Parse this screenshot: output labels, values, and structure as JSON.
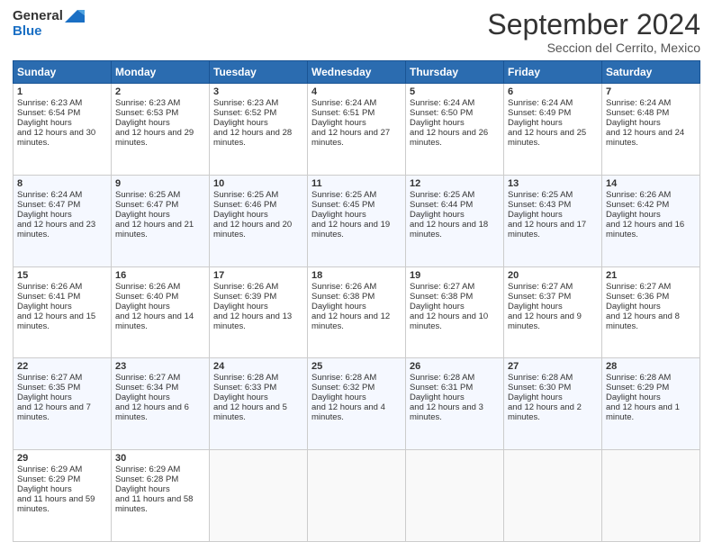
{
  "logo": {
    "line1": "General",
    "line2": "Blue"
  },
  "header": {
    "title": "September 2024",
    "subtitle": "Seccion del Cerrito, Mexico"
  },
  "columns": [
    "Sunday",
    "Monday",
    "Tuesday",
    "Wednesday",
    "Thursday",
    "Friday",
    "Saturday"
  ],
  "weeks": [
    [
      {
        "day": "1",
        "sunrise": "6:23 AM",
        "sunset": "6:54 PM",
        "daylight": "12 hours and 30 minutes."
      },
      {
        "day": "2",
        "sunrise": "6:23 AM",
        "sunset": "6:53 PM",
        "daylight": "12 hours and 29 minutes."
      },
      {
        "day": "3",
        "sunrise": "6:23 AM",
        "sunset": "6:52 PM",
        "daylight": "12 hours and 28 minutes."
      },
      {
        "day": "4",
        "sunrise": "6:24 AM",
        "sunset": "6:51 PM",
        "daylight": "12 hours and 27 minutes."
      },
      {
        "day": "5",
        "sunrise": "6:24 AM",
        "sunset": "6:50 PM",
        "daylight": "12 hours and 26 minutes."
      },
      {
        "day": "6",
        "sunrise": "6:24 AM",
        "sunset": "6:49 PM",
        "daylight": "12 hours and 25 minutes."
      },
      {
        "day": "7",
        "sunrise": "6:24 AM",
        "sunset": "6:48 PM",
        "daylight": "12 hours and 24 minutes."
      }
    ],
    [
      {
        "day": "8",
        "sunrise": "6:24 AM",
        "sunset": "6:47 PM",
        "daylight": "12 hours and 23 minutes."
      },
      {
        "day": "9",
        "sunrise": "6:25 AM",
        "sunset": "6:47 PM",
        "daylight": "12 hours and 21 minutes."
      },
      {
        "day": "10",
        "sunrise": "6:25 AM",
        "sunset": "6:46 PM",
        "daylight": "12 hours and 20 minutes."
      },
      {
        "day": "11",
        "sunrise": "6:25 AM",
        "sunset": "6:45 PM",
        "daylight": "12 hours and 19 minutes."
      },
      {
        "day": "12",
        "sunrise": "6:25 AM",
        "sunset": "6:44 PM",
        "daylight": "12 hours and 18 minutes."
      },
      {
        "day": "13",
        "sunrise": "6:25 AM",
        "sunset": "6:43 PM",
        "daylight": "12 hours and 17 minutes."
      },
      {
        "day": "14",
        "sunrise": "6:26 AM",
        "sunset": "6:42 PM",
        "daylight": "12 hours and 16 minutes."
      }
    ],
    [
      {
        "day": "15",
        "sunrise": "6:26 AM",
        "sunset": "6:41 PM",
        "daylight": "12 hours and 15 minutes."
      },
      {
        "day": "16",
        "sunrise": "6:26 AM",
        "sunset": "6:40 PM",
        "daylight": "12 hours and 14 minutes."
      },
      {
        "day": "17",
        "sunrise": "6:26 AM",
        "sunset": "6:39 PM",
        "daylight": "12 hours and 13 minutes."
      },
      {
        "day": "18",
        "sunrise": "6:26 AM",
        "sunset": "6:38 PM",
        "daylight": "12 hours and 12 minutes."
      },
      {
        "day": "19",
        "sunrise": "6:27 AM",
        "sunset": "6:38 PM",
        "daylight": "12 hours and 10 minutes."
      },
      {
        "day": "20",
        "sunrise": "6:27 AM",
        "sunset": "6:37 PM",
        "daylight": "12 hours and 9 minutes."
      },
      {
        "day": "21",
        "sunrise": "6:27 AM",
        "sunset": "6:36 PM",
        "daylight": "12 hours and 8 minutes."
      }
    ],
    [
      {
        "day": "22",
        "sunrise": "6:27 AM",
        "sunset": "6:35 PM",
        "daylight": "12 hours and 7 minutes."
      },
      {
        "day": "23",
        "sunrise": "6:27 AM",
        "sunset": "6:34 PM",
        "daylight": "12 hours and 6 minutes."
      },
      {
        "day": "24",
        "sunrise": "6:28 AM",
        "sunset": "6:33 PM",
        "daylight": "12 hours and 5 minutes."
      },
      {
        "day": "25",
        "sunrise": "6:28 AM",
        "sunset": "6:32 PM",
        "daylight": "12 hours and 4 minutes."
      },
      {
        "day": "26",
        "sunrise": "6:28 AM",
        "sunset": "6:31 PM",
        "daylight": "12 hours and 3 minutes."
      },
      {
        "day": "27",
        "sunrise": "6:28 AM",
        "sunset": "6:30 PM",
        "daylight": "12 hours and 2 minutes."
      },
      {
        "day": "28",
        "sunrise": "6:28 AM",
        "sunset": "6:29 PM",
        "daylight": "12 hours and 1 minute."
      }
    ],
    [
      {
        "day": "29",
        "sunrise": "6:29 AM",
        "sunset": "6:29 PM",
        "daylight": "11 hours and 59 minutes."
      },
      {
        "day": "30",
        "sunrise": "6:29 AM",
        "sunset": "6:28 PM",
        "daylight": "11 hours and 58 minutes."
      },
      null,
      null,
      null,
      null,
      null
    ]
  ],
  "labels": {
    "sunrise": "Sunrise: ",
    "sunset": "Sunset: ",
    "daylight": "Daylight hours"
  }
}
